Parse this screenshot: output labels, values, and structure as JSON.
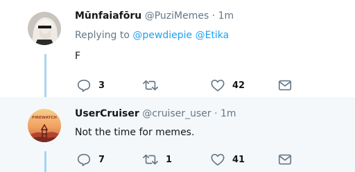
{
  "tweets": [
    {
      "display_name": "Mūnfaiafōru",
      "handle": "@PuziMemes",
      "separator": "·",
      "time": "1m",
      "replying_prefix": "Replying to",
      "mentions": [
        "@pewdiepie",
        "@Etika"
      ],
      "text": "F",
      "reply_count": "3",
      "retweet_count": "",
      "like_count": "42",
      "avatar_icon": "anime-character-avatar"
    },
    {
      "display_name": "UserCruiser",
      "handle": "@cruiser_user",
      "separator": "·",
      "time": "1m",
      "text": "Not the time for memes.",
      "reply_count": "7",
      "retweet_count": "1",
      "like_count": "41",
      "avatar_icon": "firewatch-logo-avatar",
      "avatar_text": "FIREWATCH"
    }
  ],
  "colors": {
    "accent": "#1da1f2",
    "secondary_text": "#657786",
    "thread_line": "#a6d4f2",
    "highlight_bg": "#f5f8fa"
  }
}
